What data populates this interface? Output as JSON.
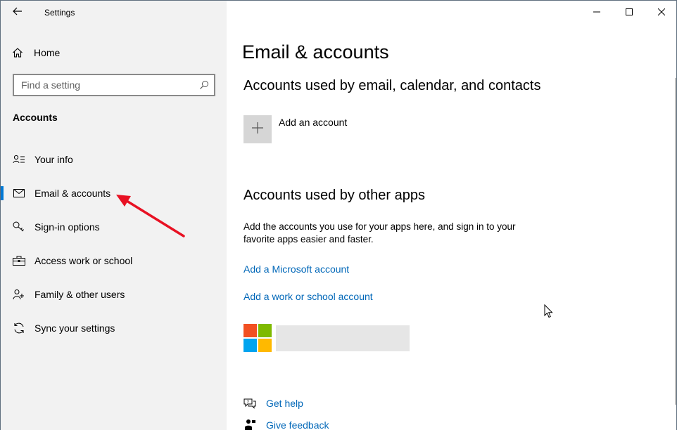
{
  "window": {
    "title": "Settings"
  },
  "sidebar": {
    "home_label": "Home",
    "search_placeholder": "Find a setting",
    "section_title": "Accounts",
    "items": [
      {
        "label": "Your info",
        "icon": "person-info-icon"
      },
      {
        "label": "Email & accounts",
        "icon": "mail-icon",
        "active": true
      },
      {
        "label": "Sign-in options",
        "icon": "key-icon"
      },
      {
        "label": "Access work or school",
        "icon": "briefcase-icon"
      },
      {
        "label": "Family & other users",
        "icon": "users-icon"
      },
      {
        "label": "Sync your settings",
        "icon": "sync-icon"
      }
    ]
  },
  "main": {
    "page_title": "Email & accounts",
    "section1_title": "Accounts used by email, calendar, and contacts",
    "add_account_label": "Add an account",
    "section2_title": "Accounts used by other apps",
    "section2_description": "Add the accounts you use for your apps here, and sign in to your favorite apps easier and faster.",
    "link_microsoft": "Add a Microsoft account",
    "link_work_school": "Add a work or school account",
    "get_help": "Get help",
    "give_feedback": "Give feedback"
  },
  "colors": {
    "accent": "#0078d4",
    "link": "#0067b8",
    "sidebar_bg": "#f2f2f2",
    "arrow": "#e81123",
    "ms_red": "#f25022",
    "ms_green": "#7fba00",
    "ms_blue": "#00a4ef",
    "ms_yellow": "#ffb900"
  }
}
